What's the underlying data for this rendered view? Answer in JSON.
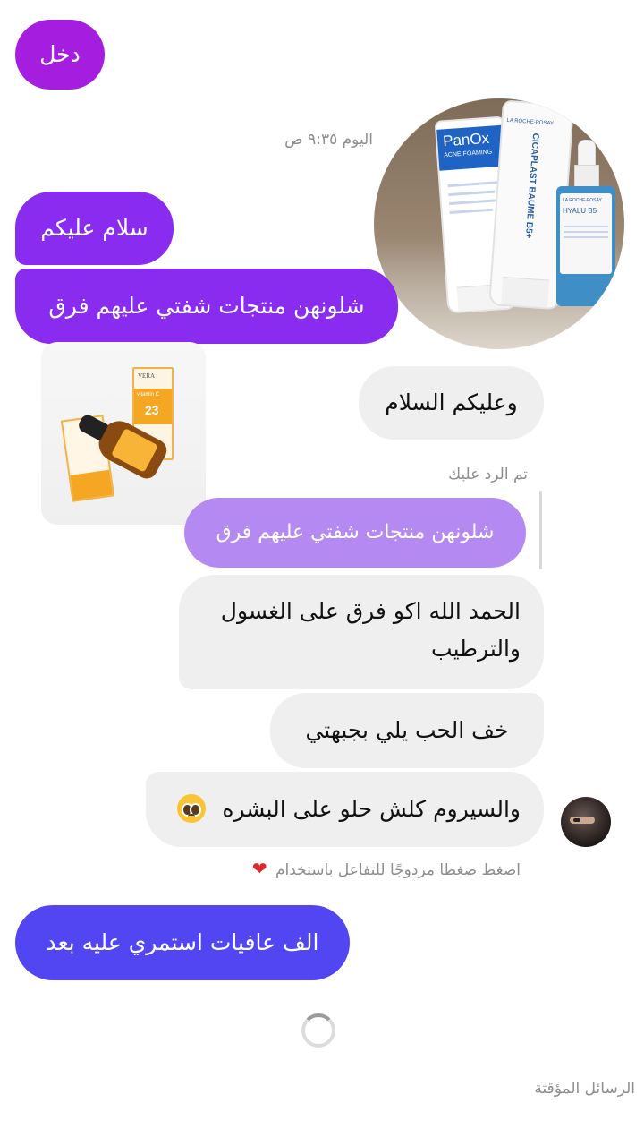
{
  "colors": {
    "sent_purple": "#a51ee0",
    "sent_violet": "#8a2cf0",
    "sent_blue": "#5146f2",
    "received_bg": "#efefef",
    "reply_quote_bg": "#b48af2",
    "heart": "#e0262b"
  },
  "messages": {
    "top_sent": "دخل",
    "timestamp": "اليوم ٩:٣٥ ص",
    "greeting_sent": "سلام عليكم",
    "question_sent": "شلونهن منتجات شفتي عليهم فرق",
    "greeting_reply": "وعليكم السلام",
    "reply_label": "تم الرد عليك",
    "quoted_message": "شلونهن منتجات شفتي عليهم فرق",
    "answer_line1": "الحمد الله اكو فرق على الغسول",
    "answer_line2": "والترطيب",
    "acne_message": "خف الحب يلي بجبهتي",
    "serum_message": "والسيروم كلش حلو على البشره",
    "serum_emoji_icon": "pleading-face-icon",
    "hint": "اضغط ضغطا مزدوجًا للتفاعل باستخدام",
    "hint_icon": "heart-icon",
    "final_sent": "الف عافيات استمري عليه بعد"
  },
  "footer": {
    "disappearing_messages": "الرسائل المؤقتة"
  },
  "images": {
    "round_photo": {
      "tube1_text": "PanOx",
      "tube1_subtext": "ACNE FOAMING",
      "tube2_text": "CICAPLAST BAUME B5+",
      "tube2_brand": "LA ROCHE-POSAY",
      "bottle_text": "HYALU B5",
      "bottle_brand": "LA ROCHE-POSAY"
    },
    "serum_photo": {
      "box_brand": "VERA",
      "box_text": "vitamin C",
      "box_number": "23"
    }
  }
}
